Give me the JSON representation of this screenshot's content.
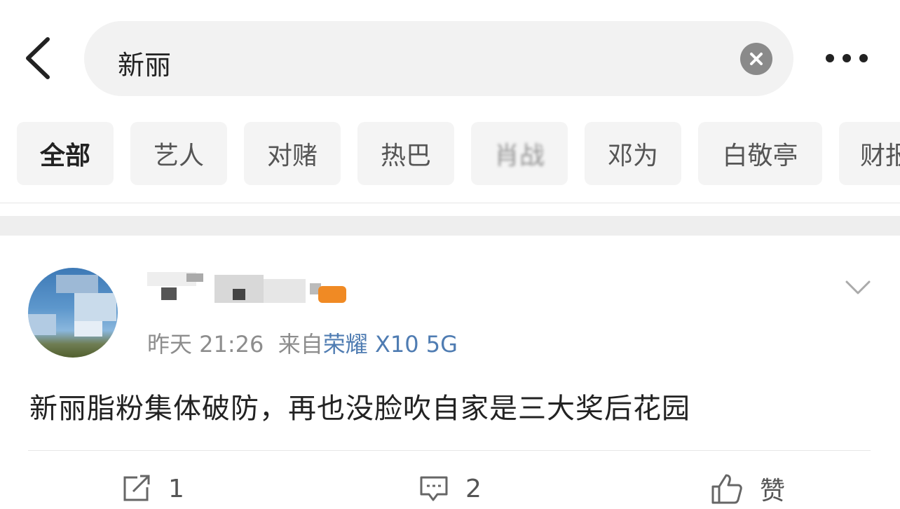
{
  "search": {
    "query": "新丽"
  },
  "tabs": [
    "全部",
    "艺人",
    "对赌",
    "热巴",
    "肖战",
    "邓为",
    "白敬亭",
    "财报"
  ],
  "post": {
    "time": "昨天 21:26",
    "source_prefix": "来自",
    "device": "荣耀 X10 5G",
    "content": "新丽脂粉集体破防，再也没脸吹自家是三大奖后花园"
  },
  "actions": {
    "repost_count": "1",
    "comment_count": "2",
    "like_label": "赞"
  },
  "colors": {
    "link": "#4f7cb2",
    "meta": "#8d8d8d",
    "badge": "#f08a24"
  }
}
